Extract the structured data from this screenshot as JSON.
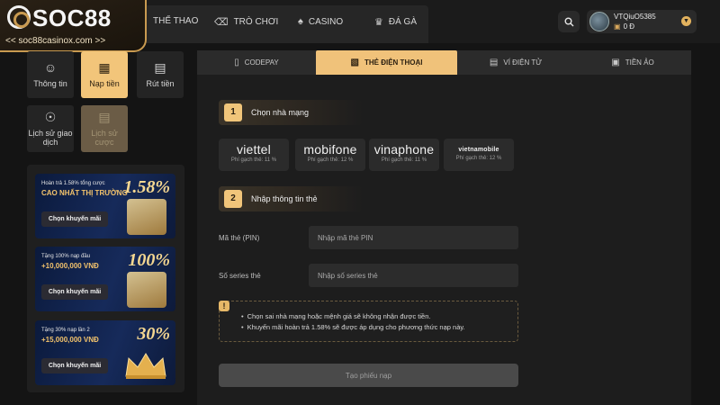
{
  "logo": {
    "text": "SOC88",
    "url_text": "<< soc88casinox.com >>"
  },
  "nav": {
    "items": [
      {
        "label": "THỂ THAO",
        "icon": "sports-icon"
      },
      {
        "label": "TRÒ CHƠI",
        "icon": "slot-777-icon"
      },
      {
        "label": "CASINO",
        "icon": "cards-icon"
      },
      {
        "label": "ĐÁ GÀ",
        "icon": "rooster-icon"
      }
    ]
  },
  "user": {
    "name": "VTQiuO5385",
    "balance": "0 Đ"
  },
  "account_menu": [
    {
      "label": "Thông tin",
      "icon": "user-icon"
    },
    {
      "label": "Nạp tiền",
      "icon": "deposit-icon"
    },
    {
      "label": "Rút tiền",
      "icon": "withdraw-icon"
    },
    {
      "label": "Lịch sử giao dịch",
      "icon": "dollar-history-icon"
    },
    {
      "label": "Lịch sử cược",
      "icon": "bet-history-icon"
    }
  ],
  "promos": [
    {
      "top": "Hoàn trả 1.58% tổng cược",
      "main": "CAO NHẤT THỊ TRƯỜNG",
      "big": "1.58%",
      "button": "Chọn khuyến mãi"
    },
    {
      "top": "Tặng 100% nạp đầu",
      "main": "+10,000,000 VNĐ",
      "big": "100%",
      "button": "Chọn khuyến mãi"
    },
    {
      "top": "Tặng 30% nạp lần 2",
      "main": "+15,000,000 VNĐ",
      "big": "30%",
      "button": "Chọn khuyến mãi"
    }
  ],
  "tabs": [
    {
      "label": "CODEPAY",
      "icon": "phone-icon"
    },
    {
      "label": "THẺ ĐIỆN THOẠI",
      "icon": "sim-card-icon"
    },
    {
      "label": "VÍ ĐIỆN TỬ",
      "icon": "wallet-icon"
    },
    {
      "label": "TIỀN ẢO",
      "icon": "crypto-icon"
    }
  ],
  "step1": {
    "num": "1",
    "title": "Chọn nhà mạng"
  },
  "carriers": [
    {
      "name": "viettel",
      "fee": "Phí gạch thẻ: 11 %"
    },
    {
      "name": "mobifone",
      "fee": "Phí gạch thẻ: 12 %"
    },
    {
      "name": "vinaphone",
      "fee": "Phí gạch thẻ: 11 %"
    },
    {
      "name": "vietnamobile",
      "fee": "Phí gạch thẻ: 12 %"
    }
  ],
  "step2": {
    "num": "2",
    "title": "Nhập thông tin thẻ"
  },
  "fields": {
    "pin": {
      "label": "Mã thẻ (PIN)",
      "placeholder": "Nhập mã thẻ PIN",
      "value": ""
    },
    "serial": {
      "label": "Số series thẻ",
      "placeholder": "Nhập số series thẻ",
      "value": ""
    }
  },
  "notice": {
    "icon_text": "!",
    "lines": [
      "Chọn sai nhà mạng hoặc mệnh giá sẽ không nhận được tiền.",
      "Khuyến mãi hoàn trả 1.58% sẽ được áp dụng cho phương thức nạp này."
    ]
  },
  "submit_label": "Tạo phiếu nạp",
  "colors": {
    "accent": "#f0c27a",
    "background": "#141414",
    "panel": "#1d1d1d"
  }
}
